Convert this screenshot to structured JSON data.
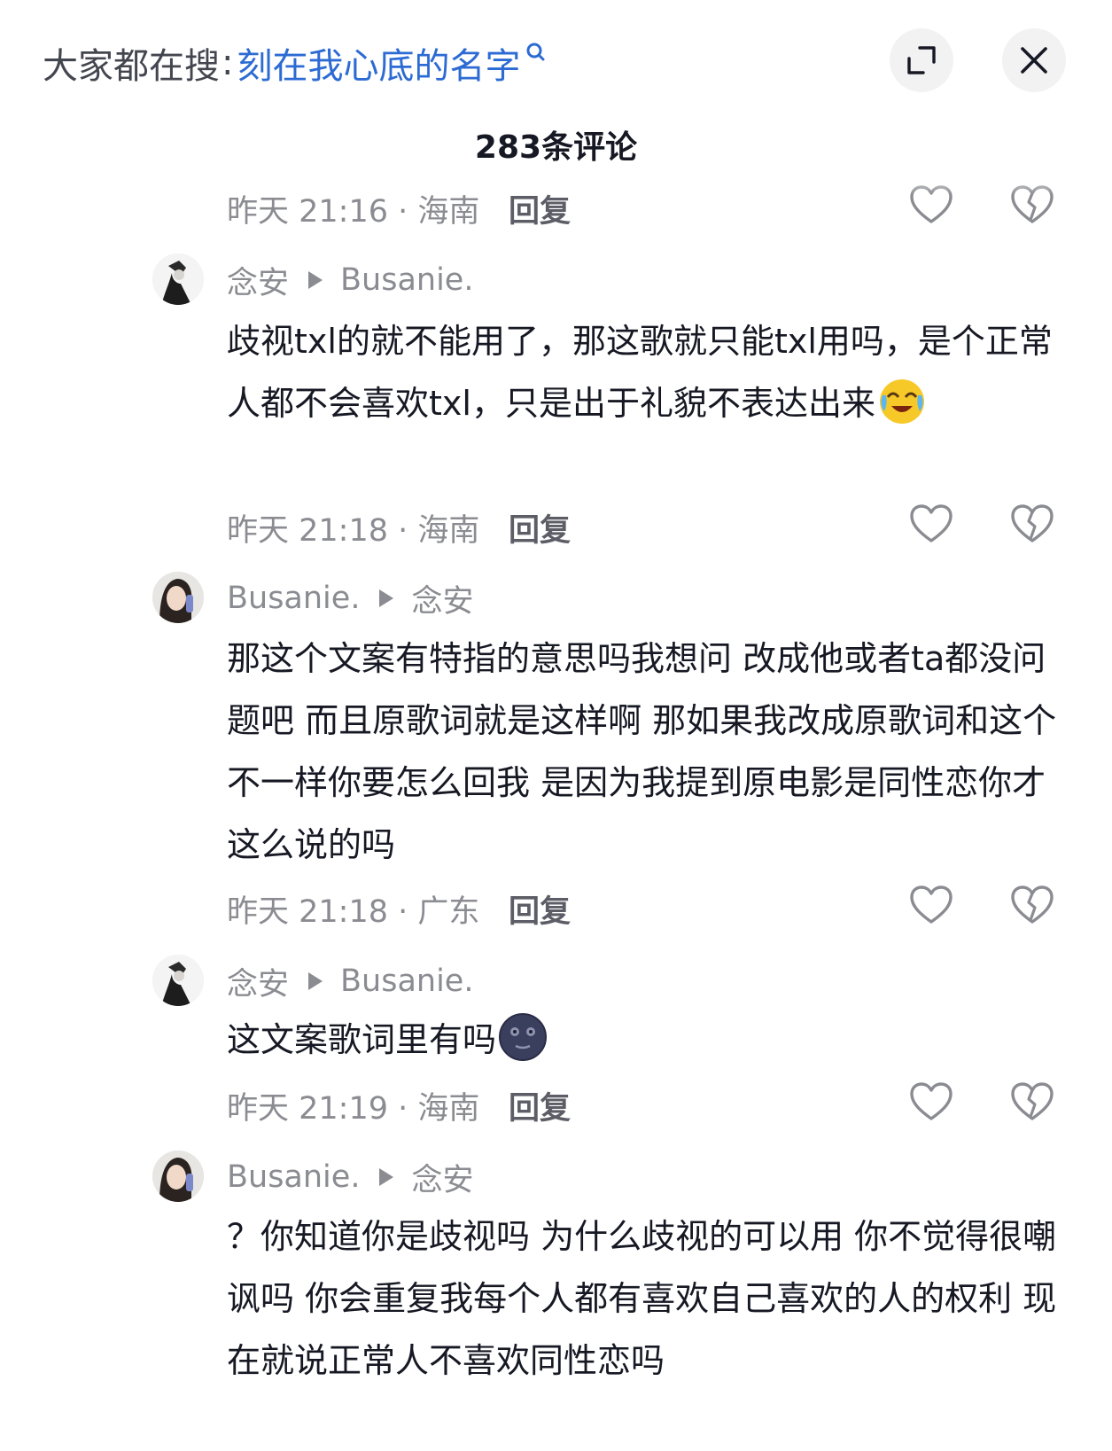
{
  "header": {
    "search_prefix": "大家都在搜",
    "search_separator": ":",
    "search_term": "刻在我心底的名字",
    "comment_count_label": "283条评论",
    "accent_color": "#2c6bd3"
  },
  "partial_row": {
    "meta": "昨天 21:16 · 海南",
    "reply_label": "回复"
  },
  "comments": [
    {
      "author": "念安",
      "reply_to": "Busanie.",
      "text": "歧视txl的就不能用了，那这歌就只能txl用吗，是个正常人都不会喜欢txl，只是出于礼貌不表达出来",
      "emoji": "crying-laughing-emoji",
      "meta": "昨天 21:18 · 海南",
      "reply_label": "回复"
    },
    {
      "author": "Busanie.",
      "reply_to": "念安",
      "text": "那这个文案有特指的意思吗我想问 改成他或者ta都没问题吧 而且原歌词就是这样啊 那如果我改成原歌词和这个不一样你要怎么回我 是因为我提到原电影是同性恋你才这么说的吗",
      "meta": "昨天 21:18 · 广东",
      "reply_label": "回复"
    },
    {
      "author": "念安",
      "reply_to": "Busanie.",
      "text": "这文案歌词里有吗",
      "emoji": "dark-moon-face-emoji",
      "meta": "昨天 21:19 · 海南",
      "reply_label": "回复"
    },
    {
      "author": "Busanie.",
      "reply_to": "念安",
      "text": "？你知道你是歧视吗 为什么歧视的可以用 你不觉得很嘲讽吗 你会重复我每个人都有喜欢自己喜欢的人的权利 现在就说正常人不喜欢同性恋吗"
    }
  ],
  "icons": {
    "search": "search-icon",
    "expand": "expand-icon",
    "close": "close-icon",
    "like": "heart-icon",
    "dislike": "broken-heart-icon"
  }
}
